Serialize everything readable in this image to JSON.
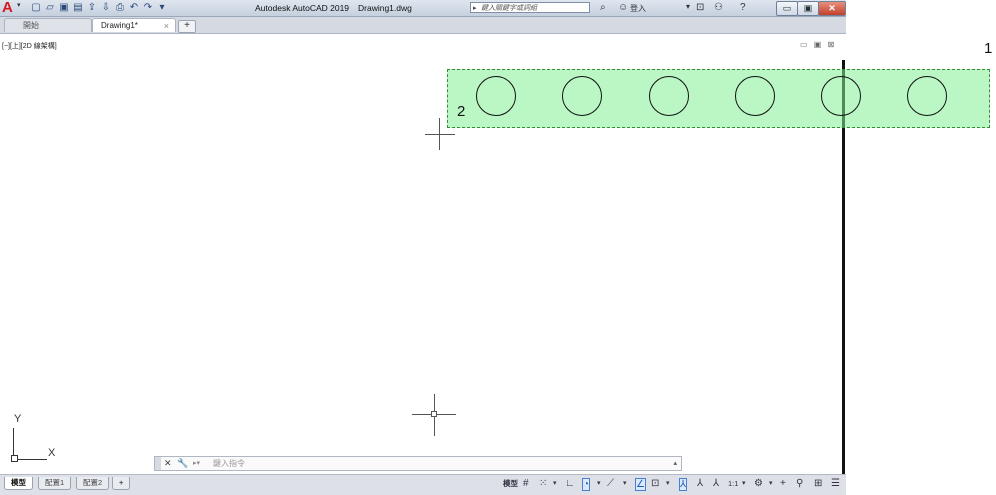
{
  "titlebar": {
    "app_logo": "A",
    "qat_icons": [
      "new-icon",
      "open-icon",
      "save-icon",
      "save-as-icon",
      "upload-icon",
      "download-icon",
      "plot-icon",
      "undo-icon",
      "redo-icon"
    ],
    "app_name": "Autodesk AutoCAD 2019",
    "file_name": "Drawing1.dwg",
    "search_placeholder": "鍵入關鍵字或詞組",
    "signin_label": "登入",
    "window_buttons": {
      "minimize": "▭",
      "restore": "▣",
      "close": "✕"
    }
  },
  "tabs": {
    "start_label": "開始",
    "drawing_label": "Drawing1*",
    "close_glyph": "×",
    "add_glyph": "+"
  },
  "viewport": {
    "label": "[−][上][2D 線架構]",
    "controls": "▭ ▣ ⊠"
  },
  "annotations": {
    "callout_1": "1",
    "callout_2": "2"
  },
  "ucs": {
    "x": "X",
    "y": "Y"
  },
  "command_line": {
    "placeholder": "鍵入指令",
    "close_glyph": "✕",
    "wrench_glyph": "🔧"
  },
  "layout_tabs": [
    "模型",
    "配置1",
    "配置2",
    "+"
  ],
  "statusbar": {
    "model_label": "模型",
    "scale_label": "1:1"
  },
  "colors": {
    "selection_fill": "#82f096",
    "selection_border": "#3a8a3a",
    "logo_red": "#d71920"
  }
}
